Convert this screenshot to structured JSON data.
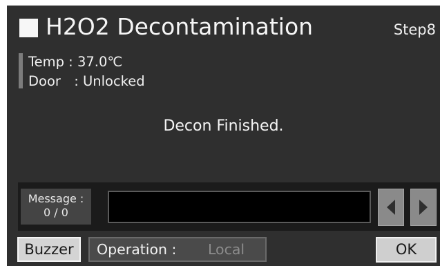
{
  "header": {
    "title": "H2O2 Decontamination",
    "step": "Step8"
  },
  "status": {
    "temp_label": "Temp",
    "temp_separator": ": ",
    "temp_value": "37.0℃",
    "door_label": "Door",
    "door_separator": ": ",
    "door_value": "Unlocked"
  },
  "main": {
    "status_message": "Decon Finished."
  },
  "message": {
    "label": "Message :",
    "counter": "0 / 0",
    "content": ""
  },
  "footer": {
    "buzzer_label": "Buzzer",
    "operation_label": "Operation :",
    "operation_value": "Local",
    "ok_label": "OK"
  },
  "icons": {
    "prev": "arrow-left-icon",
    "next": "arrow-right-icon",
    "title_marker": "square-icon"
  },
  "colors": {
    "background": "#2f2f2f",
    "text": "#f2f2f2",
    "button_face": "#d4d4d4",
    "inactive_text": "#8c8c8c"
  }
}
